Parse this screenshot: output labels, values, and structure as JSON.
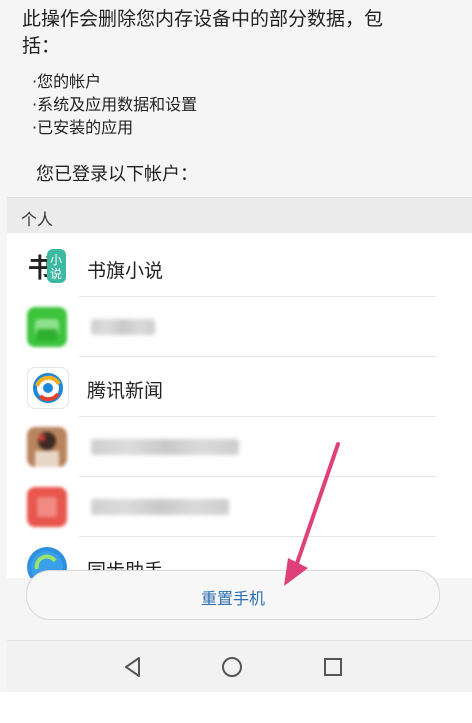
{
  "warning": {
    "line1": "此操作会删除您内存设备中的部分数据，包",
    "line2": "括：",
    "items": [
      "·您的帐户",
      "·系统及应用数据和设置",
      "·已安装的应用"
    ]
  },
  "logged_in_label": "您已登录以下帐户：",
  "section_title": "个人",
  "accounts": [
    {
      "name": "书旗小说",
      "icon": "shuqi-novel-icon"
    },
    {
      "name": "",
      "icon": "wechat-icon"
    },
    {
      "name": "腾讯新闻",
      "icon": "tencent-news-icon"
    },
    {
      "name": "",
      "icon": "user-avatar-icon"
    },
    {
      "name": "",
      "icon": "red-app-icon"
    },
    {
      "name": "同步助手",
      "icon": "sync-assistant-icon"
    }
  ],
  "reset_button": "重置手机",
  "shuqi_logo_text": "书小说",
  "nav": [
    "back-icon",
    "home-icon",
    "recents-icon"
  ],
  "colors": {
    "accent": "#2f6fb0",
    "arrow": "#e0407a"
  }
}
